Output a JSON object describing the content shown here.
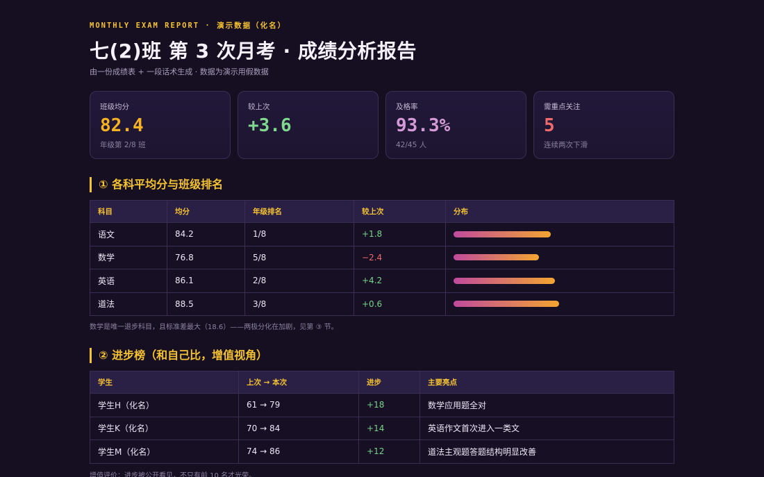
{
  "header": {
    "eyebrow": "MONTHLY EXAM REPORT · 演示数据（化名）",
    "title": "七(2)班 第 3 次月考 · 成绩分析报告",
    "subtitle": "由一份成绩表 + 一段话术生成 · 数据为演示用假数据"
  },
  "kpis": [
    {
      "label": "班级均分",
      "value": "82.4",
      "note": "年级第 2/8 班",
      "color": "#f5b324"
    },
    {
      "label": "较上次",
      "value": "+3.6",
      "note": "",
      "color": "#7fd88e"
    },
    {
      "label": "及格率",
      "value": "93.3%",
      "note": "42/45 人",
      "color": "#d59ad6"
    },
    {
      "label": "需重点关注",
      "value": "5",
      "note": "连续两次下滑",
      "color": "#ef6a6a"
    }
  ],
  "section1": {
    "title": "① 各科平均分与班级排名",
    "headers": [
      "科目",
      "均分",
      "年级排名",
      "较上次",
      "分布"
    ],
    "rows": [
      {
        "subject": "语文",
        "avg": "84.2",
        "rank": "1/8",
        "delta": "+1.8",
        "trend": "pos",
        "dist": 0.84
      },
      {
        "subject": "数学",
        "avg": "76.8",
        "rank": "5/8",
        "delta": "−2.4",
        "trend": "neg",
        "dist": 0.768
      },
      {
        "subject": "英语",
        "avg": "86.1",
        "rank": "2/8",
        "delta": "+4.2",
        "trend": "pos",
        "dist": 0.861
      },
      {
        "subject": "道法",
        "avg": "88.5",
        "rank": "3/8",
        "delta": "+0.6",
        "trend": "pos",
        "dist": 0.885
      }
    ],
    "note": "数学是唯一退步科目，且标准差最大（18.6）——两极分化在加剧，见第 ③ 节。"
  },
  "section2": {
    "title": "② 进步榜（和自己比，增值视角）",
    "headers": [
      "学生",
      "上次 → 本次",
      "进步",
      "主要亮点"
    ],
    "rows": [
      {
        "student": "学生H（化名）",
        "scores": "61 → 79",
        "gain": "+18",
        "highlight": "数学应用题全对"
      },
      {
        "student": "学生K（化名）",
        "scores": "70 → 84",
        "gain": "+14",
        "highlight": "英语作文首次进入一类文"
      },
      {
        "student": "学生M（化名）",
        "scores": "74 → 86",
        "gain": "+12",
        "highlight": "道法主观题答题结构明显改善"
      }
    ],
    "note": "增值评价：进步被公开看见，不只有前 10 名才光荣。"
  }
}
